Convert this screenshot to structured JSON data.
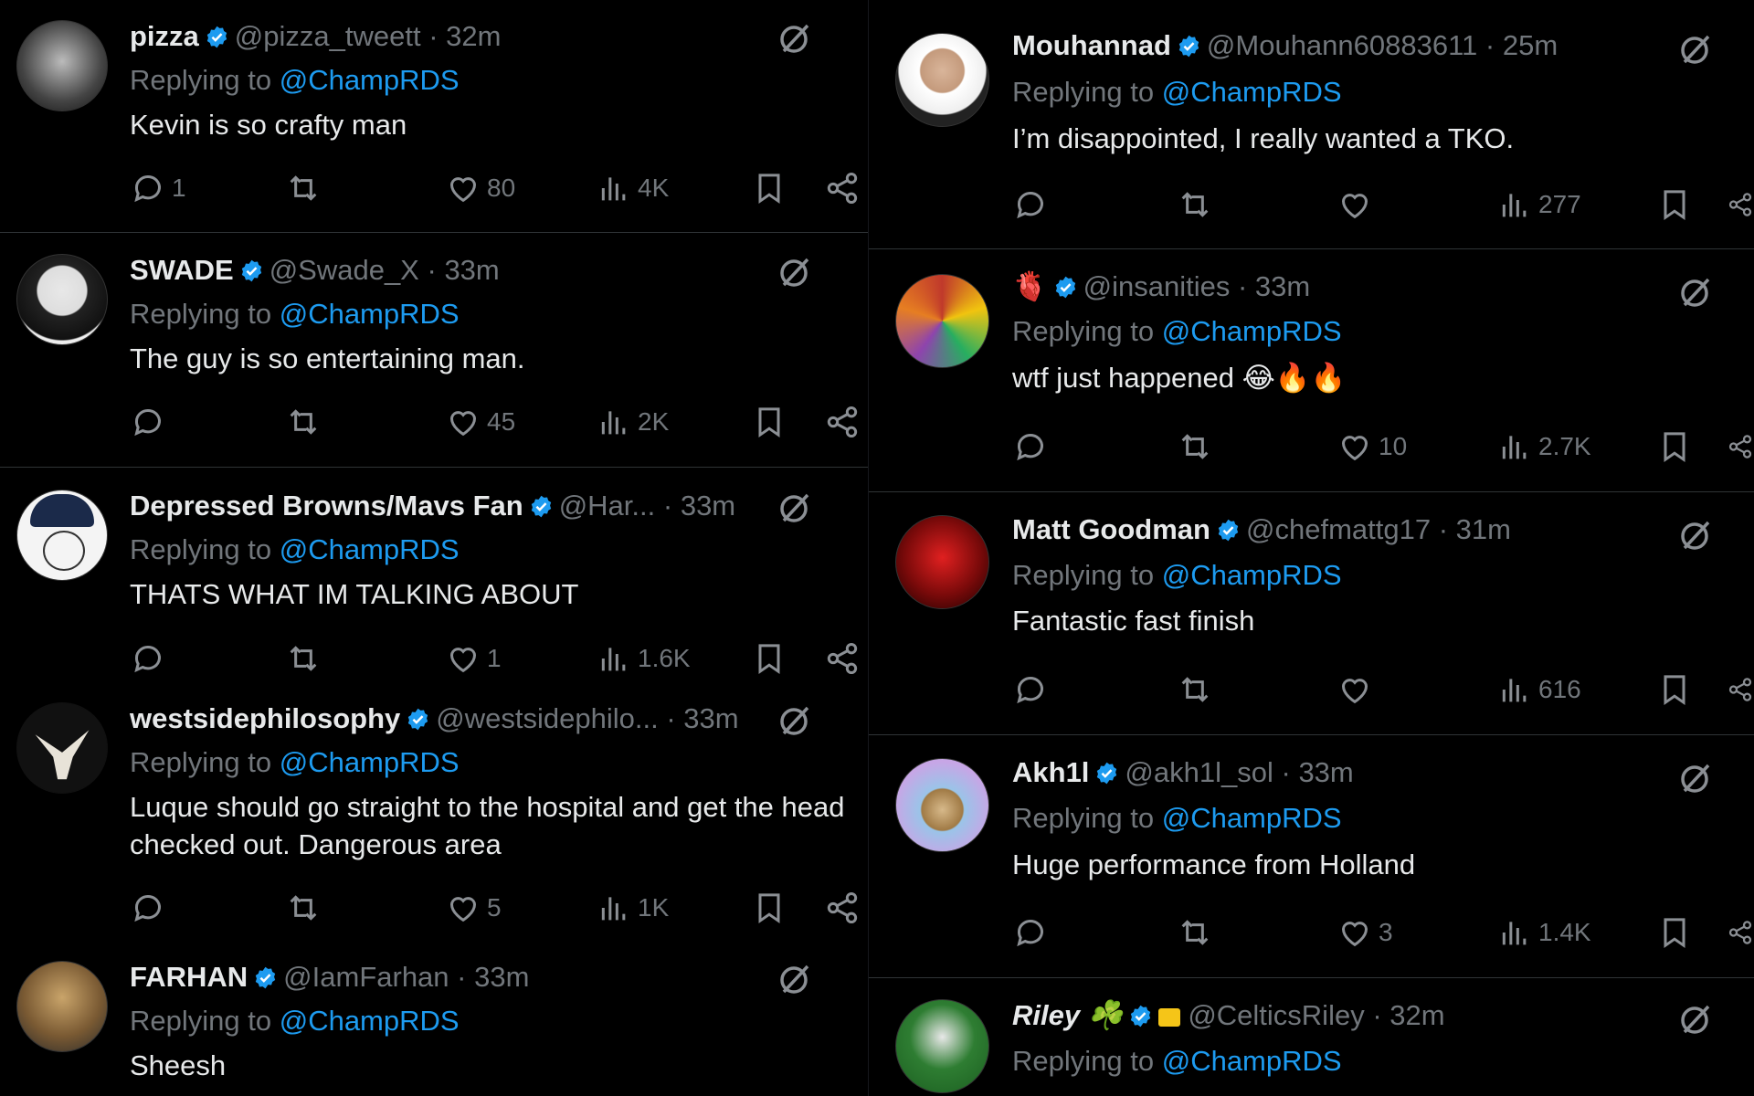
{
  "reply_prefix": "Replying to ",
  "colors": {
    "bg": "#000000",
    "text": "#e7e9ea",
    "muted": "#71767b",
    "link": "#1d9bf0",
    "verified": "#1d9bf0",
    "divider": "#2f3336"
  },
  "icons": [
    "verified-badge-icon",
    "grok-icon",
    "reply-icon",
    "retweet-icon",
    "like-icon",
    "views-icon",
    "bookmark-icon",
    "share-icon"
  ],
  "left": [
    {
      "name": "pizza",
      "handle": "@pizza_tweett",
      "dot": " · ",
      "time": "32m",
      "replying_to": "@ChampRDS",
      "text": "Kevin is so crafty man",
      "replies": "1",
      "retweets": "",
      "likes": "80",
      "views": "4K"
    },
    {
      "name": "SWADE",
      "handle": "@Swade_X",
      "dot": " · ",
      "time": "33m",
      "replying_to": "@ChampRDS",
      "text": "The guy is so entertaining man.",
      "replies": "",
      "retweets": "",
      "likes": "45",
      "views": "2K"
    },
    {
      "name": "Depressed Browns/Mavs Fan",
      "handle": "@Har...",
      "dot": "  · ",
      "time": "33m",
      "replying_to": "@ChampRDS",
      "text": "THATS WHAT IM TALKING ABOUT",
      "replies": "",
      "retweets": "",
      "likes": "1",
      "views": "1.6K"
    },
    {
      "name": "westsidephilosophy",
      "handle": "@westsidephilo...",
      "dot": " · ",
      "time": "33m",
      "replying_to": "@ChampRDS",
      "text": "Luque should go straight to the hospital and get the head checked out. Dangerous area",
      "replies": "",
      "retweets": "",
      "likes": "5",
      "views": "1K"
    },
    {
      "name": "FARHAN",
      "handle": "@IamFarhan",
      "dot": " · ",
      "time": "33m",
      "replying_to": "@ChampRDS",
      "text": "Sheesh",
      "replies": "",
      "retweets": "",
      "likes": "",
      "views": ""
    }
  ],
  "right": [
    {
      "name": "Mouhannad",
      "handle": "@Mouhann60883611",
      "dot": " · ",
      "time": "25m",
      "replying_to": "@ChampRDS",
      "text": "I’m disappointed, I really wanted a TKO.",
      "replies": "",
      "retweets": "",
      "likes": "",
      "views": "277"
    },
    {
      "name": "🫀",
      "handle": "@insanities",
      "dot": " · ",
      "time": "33m",
      "replying_to": "@ChampRDS",
      "text": "wtf just happened 😂🔥🔥",
      "replies": "",
      "retweets": "",
      "likes": "10",
      "views": "2.7K"
    },
    {
      "name": "Matt Goodman",
      "handle": "@chefmattg17",
      "dot": " · ",
      "time": "31m",
      "replying_to": "@ChampRDS",
      "text": "Fantastic fast finish",
      "replies": "",
      "retweets": "",
      "likes": "",
      "views": "616"
    },
    {
      "name": "Akh1l",
      "handle": "@akh1l_sol",
      "dot": " · ",
      "time": "33m",
      "replying_to": "@ChampRDS",
      "text": "Huge performance from Holland",
      "replies": "",
      "retweets": "",
      "likes": "3",
      "views": "1.4K"
    },
    {
      "name": "Riley ☘️",
      "handle": "@CelticsRiley",
      "dot": " · ",
      "time": "32m",
      "replying_to": "@ChampRDS",
      "text": "",
      "replies": "",
      "retweets": "",
      "likes": "",
      "views": ""
    }
  ]
}
